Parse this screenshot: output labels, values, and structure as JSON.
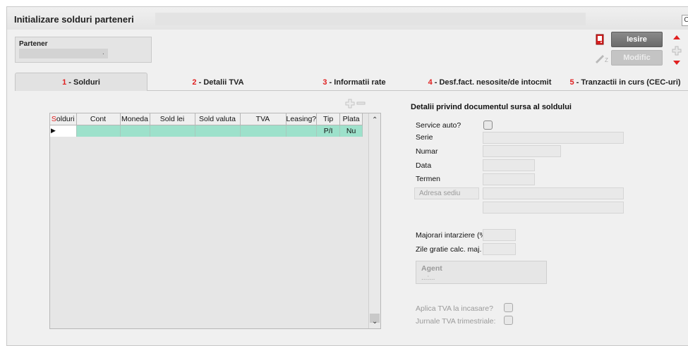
{
  "window": {
    "title": "Initializare solduri parteneri",
    "corner_label": "C"
  },
  "partner": {
    "label": "Partener",
    "value": "."
  },
  "toolbar": {
    "exit_label": "Iesire",
    "modify_label": "Modific"
  },
  "tabs": [
    {
      "num": "1",
      "label": " - Solduri",
      "active": true
    },
    {
      "num": "2",
      "label": " - Detalii TVA",
      "active": false
    },
    {
      "num": "3",
      "label": " - Informatii rate",
      "active": false
    },
    {
      "num": "4",
      "label": " - Desf.fact. nesosite/de intocmit",
      "active": false
    },
    {
      "num": "5",
      "label": " - Tranzactii in curs (CEC-uri)",
      "active": false
    }
  ],
  "grid": {
    "columns": [
      {
        "label_first": "S",
        "label_rest": "olduri"
      },
      {
        "label": "Cont"
      },
      {
        "label": "Moneda"
      },
      {
        "label": "Sold lei"
      },
      {
        "label": "Sold valuta"
      },
      {
        "label": "TVA"
      },
      {
        "label": "Leasing?"
      },
      {
        "label": "Tip"
      },
      {
        "label": "Plata"
      }
    ],
    "rows": [
      {
        "marker": "▶",
        "cells": [
          "",
          "",
          "",
          "",
          "",
          "",
          "",
          "P/I",
          "Nu"
        ]
      }
    ]
  },
  "details": {
    "title": "Detalii privind documentul sursa al soldului",
    "service_auto_label": "Service auto?",
    "service_auto_checked": false,
    "serie_label": "Serie",
    "serie_value": "",
    "numar_label": "Numar",
    "numar_value": "",
    "data_label": "Data",
    "data_value": "",
    "termen_label": "Termen",
    "termen_value": "",
    "adresa_label": "Adresa sediu",
    "adresa_value_1": "",
    "adresa_value_2": "",
    "majorari_label": "Majorari intarziere (%)",
    "majorari_value": "",
    "zile_label": "Zile gratie calc. maj.",
    "zile_value": "",
    "agent_label": "Agent",
    "agent_value": "...:...",
    "aplica_tva_label": "Aplica TVA la incasare?",
    "aplica_tva_checked": false,
    "jurnale_label": "Jurnale TVA trimestriale:",
    "jurnale_checked": false
  },
  "colors": {
    "accent_red": "#e02020",
    "row_highlight": "#9de1cb",
    "window_bg": "#f0f0f0"
  }
}
